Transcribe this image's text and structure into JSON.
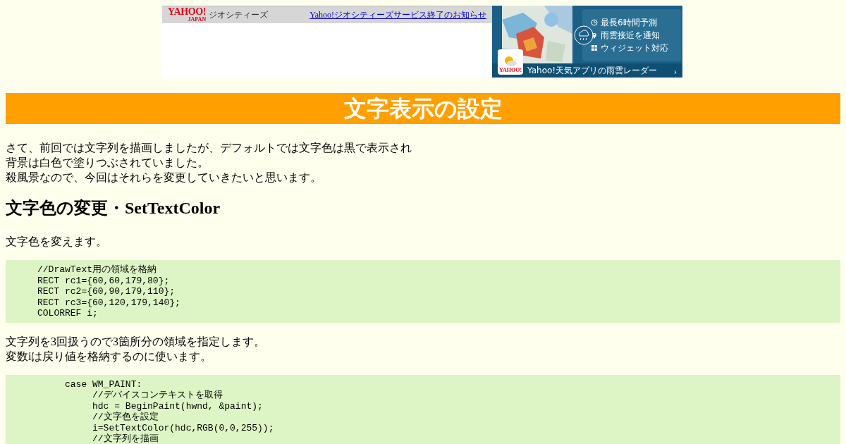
{
  "banner": {
    "logo": "YAHOO!",
    "logo_sub": "JAPAN",
    "site_name": "ジオシティーズ",
    "notice_link": "Yahoo!ジオシティーズサービス終了のお知らせ"
  },
  "ad": {
    "features": [
      "最長6時間予測",
      "雨雲接近を通知",
      "ウィジェット対応"
    ],
    "app_logo": "YAHOO!",
    "caption": "Yahoo!天気アプリの雨雲レーダー",
    "arrow": "›"
  },
  "title": "文字表示の設定",
  "sections": [
    {
      "kind": "paragraph",
      "lines": [
        "さて、前回では文字列を描画しましたが、デフォルトでは文字色は黒で表示され",
        "背景は白色で塗りつぶされていました。",
        "殺風景なので、今回はそれらを変更していきたいと思います。"
      ]
    },
    {
      "kind": "heading",
      "text": "文字色の変更・SetTextColor"
    },
    {
      "kind": "paragraph",
      "lines": [
        "文字色を変えます。"
      ]
    },
    {
      "kind": "code",
      "text": "     //DrawText用の領域を格納\n     RECT rc1={60,60,179,80};\n     RECT rc2={60,90,179,110};\n     RECT rc3={60,120,179,140};\n     COLORREF i;"
    },
    {
      "kind": "paragraph",
      "lines": [
        "文字列を3回扱うので3箇所分の領域を指定します。",
        "変数iは戻り値を格納するのに使います。"
      ]
    },
    {
      "kind": "code",
      "text": "          case WM_PAINT:\n               //デバイスコンテキストを取得\n               hdc = BeginPaint(hwnd, &paint);\n               //文字色を設定\n               i=SetTextColor(hdc,RGB(0,0,255));\n               //文字列を描画"
    }
  ]
}
